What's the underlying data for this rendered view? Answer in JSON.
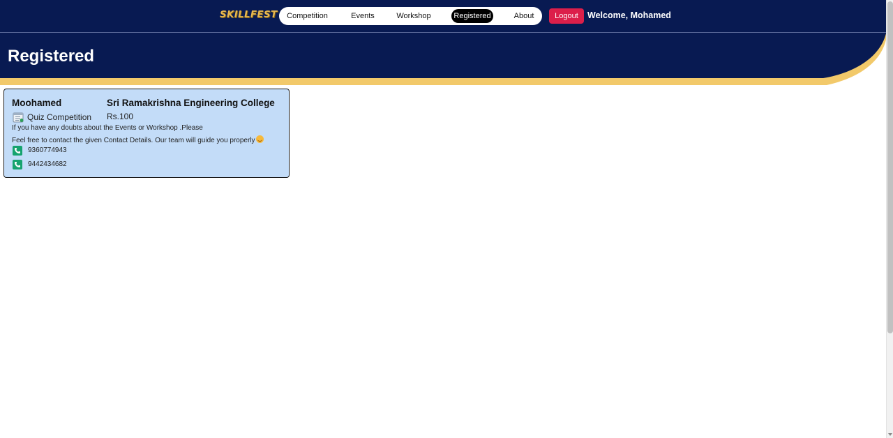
{
  "header": {
    "brand": "SKILLFEST",
    "nav": [
      {
        "label": "Competition",
        "active": false
      },
      {
        "label": "Events",
        "active": false
      },
      {
        "label": "Workshop",
        "active": false
      },
      {
        "label": "Registered",
        "active": true
      },
      {
        "label": "About",
        "active": false
      }
    ],
    "logout_label": "Logout",
    "welcome": "Welcome, Mohamed"
  },
  "page": {
    "title": "Registered"
  },
  "card": {
    "name": "Moohamed",
    "college": "Sri Ramakrishna Engineering College",
    "event": "Quiz Competition",
    "event_icon": "calendar-icon",
    "price": "Rs.100",
    "info_line1": "If you have any doubts about the Events or Workshop .Please",
    "info_line2": "Feel free to contact the given Contact Details. Our team will guide you properly",
    "phones": [
      "9360774943",
      "9442434682"
    ]
  },
  "colors": {
    "navy": "#081a52",
    "gold": "#f2c96a",
    "card_bg": "#c3dcf8",
    "logout": "#dc1f4a",
    "phone_icon": "#16a36f"
  }
}
